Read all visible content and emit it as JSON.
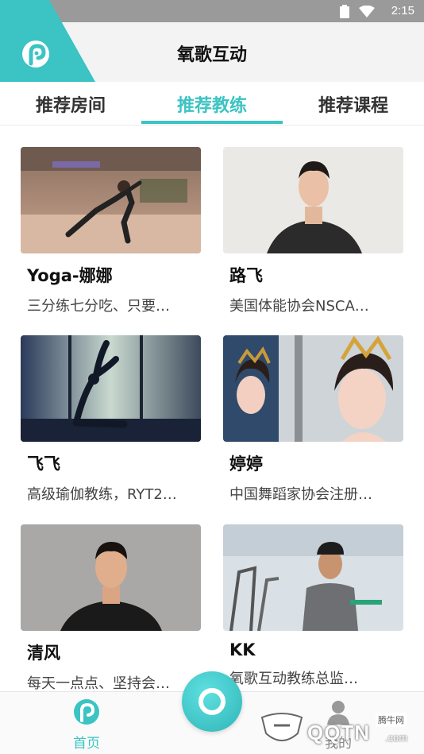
{
  "status_bar": {
    "time": "2:15"
  },
  "header": {
    "title": "氧歌互动",
    "logo_icon": "app-logo-icon"
  },
  "tabs": [
    {
      "label": "推荐房间",
      "active": false
    },
    {
      "label": "推荐教练",
      "active": true
    },
    {
      "label": "推荐课程",
      "active": false
    }
  ],
  "coaches": [
    {
      "name": "Yoga-娜娜",
      "desc": "三分练七分吃、只要…",
      "photo": "yoga-studio-pose-photo"
    },
    {
      "name": "路飞",
      "desc": "美国体能协会NSCA…",
      "photo": "male-trainer-portrait-photo"
    },
    {
      "name": "飞飞",
      "desc": "高级瑜伽教练，RYT2…",
      "photo": "yoga-silhouette-window-photo"
    },
    {
      "name": "婷婷",
      "desc": "中国舞蹈家协会注册…",
      "photo": "dancer-costume-photo"
    },
    {
      "name": "清风",
      "desc": "每天一点点、坚持会…",
      "photo": "male-coach-portrait-photo"
    },
    {
      "name": "KK",
      "desc": "氧歌互动教练总监…",
      "photo": "gym-trainer-photo"
    }
  ],
  "bottom_nav": {
    "home_label": "首页",
    "me_label": "我的"
  },
  "watermark": {
    "text": "QQTN",
    "badge": "腾牛网",
    "suffix": ".com"
  },
  "colors": {
    "accent": "#3cc3c3",
    "status_bar": "#9a9a9a",
    "header_bg": "#f3f3f3"
  }
}
